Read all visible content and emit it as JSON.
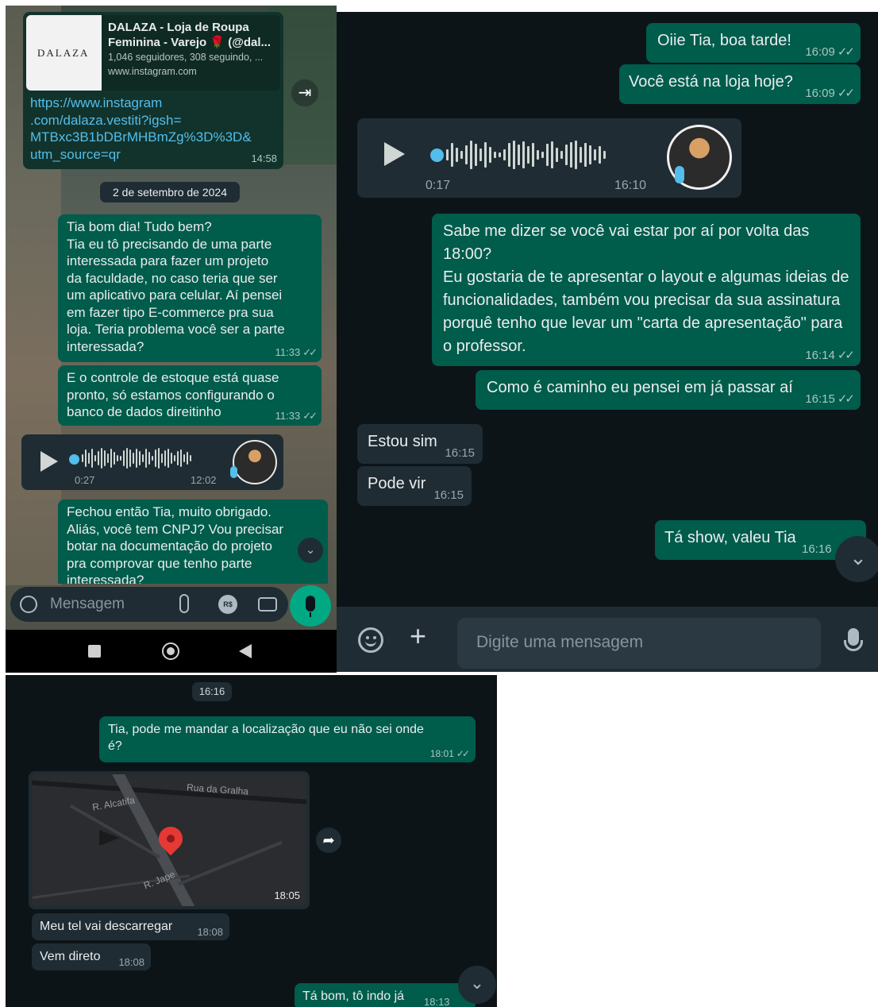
{
  "left_chat": {
    "link_preview": {
      "logo_text": "DALAZA",
      "title": "DALAZA - Loja de Roupa Feminina - Varejo 🌹 (@dal...",
      "subtitle": "1,046 seguidores, 308 seguindo, ...",
      "domain": "www.instagram.com",
      "url": "https://www.instagram\n.com/dalaza.vestiti?igsh=\nMTBxc3B1bDBrMHBmZg%3D%3D&\nutm_source=qr",
      "time": "14:58"
    },
    "date_chip": "2 de setembro de 2024",
    "messages": [
      {
        "text": "Tia bom dia! Tudo bem?\nTia eu tô precisando de uma parte\ninteressada para fazer um projeto\nda faculdade, no caso teria que ser\num aplicativo para celular. Aí pensei\nem fazer tipo E-commerce pra sua\nloja. Teria problema você ser a parte\ninteressada?",
        "time": "11:33"
      },
      {
        "text": "E o controle de estoque está quase\npronto, só estamos configurando o\nbanco de dados direitinho",
        "time": "11:33"
      }
    ],
    "voice": {
      "duration": "0:27",
      "time": "12:02"
    },
    "last_message": "Fechou então Tia, muito obrigado.\nAliás, você tem CNPJ? Vou precisar\nbotar na documentação do projeto\npra comprovar que tenho parte\ninteressada?",
    "composer_placeholder": "Mensagem"
  },
  "right_chat": {
    "messages_top": [
      {
        "text": "Oiie Tia, boa tarde!",
        "time": "16:09"
      },
      {
        "text": "Você está na loja hoje?",
        "time": "16:09"
      }
    ],
    "voice": {
      "duration": "0:17",
      "time": "16:10"
    },
    "long_message": {
      "text": "Sabe me dizer se você vai estar por aí por volta das\n18:00?\nEu gostaria de te apresentar o layout e algumas ideias de\nfuncionalidades, também vou precisar da sua assinatura\nporquê tenho que levar um \"carta de apresentação\" para\no professor.",
      "time": "16:14"
    },
    "msg_caminho": {
      "text": "Como é caminho eu pensei em já passar aí",
      "time": "16:15"
    },
    "incoming": [
      {
        "text": "Estou sim",
        "time": "16:15"
      },
      {
        "text": "Pode vir",
        "time": "16:15"
      }
    ],
    "last_out": {
      "text": "Tá show, valeu Tia",
      "time": "16:16"
    },
    "composer_placeholder": "Digite uma mensagem"
  },
  "bottom_chat": {
    "time_chip": "16:16",
    "location_request": {
      "text": "Tia, pode me mandar a localização que eu não sei onde\né?",
      "time": "18:01"
    },
    "map": {
      "street1": "Rua da Gralha",
      "street2": "R. Alcatifa",
      "street3": "R. Jape",
      "time": "18:05"
    },
    "incoming": [
      {
        "text": "Meu tel vai descarregar",
        "time": "18:08"
      },
      {
        "text": "Vem direto",
        "time": "18:08"
      }
    ],
    "last_out": {
      "text": "Tá bom, tô indo já",
      "time": "18:13"
    }
  },
  "colors": {
    "outgoing": "#005c4b",
    "incoming": "#1f2c33",
    "background": "#0d1418",
    "accent": "#00a884",
    "link": "#53bdeb",
    "map_pin": "#e53935"
  }
}
